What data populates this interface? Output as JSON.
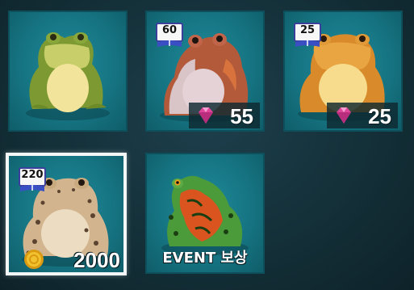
{
  "items": [
    {
      "name": "green-frog",
      "badge": null,
      "price": null
    },
    {
      "name": "red-frog",
      "badge": "60",
      "price": "55",
      "currency": "gem-icon"
    },
    {
      "name": "orange-frog",
      "badge": "25",
      "price": "25",
      "currency": "gem-icon"
    },
    {
      "name": "spotted-toad",
      "badge": "220",
      "price": "2000",
      "currency": "coin-icon",
      "selected": true
    },
    {
      "name": "tomato-frog",
      "badge": null,
      "label": "EVENT 보상"
    }
  ],
  "colors": {
    "tile": "#167482",
    "selected_border": "#f4f7f7",
    "gem": "#e0459c",
    "coin": "#f2c12e"
  }
}
